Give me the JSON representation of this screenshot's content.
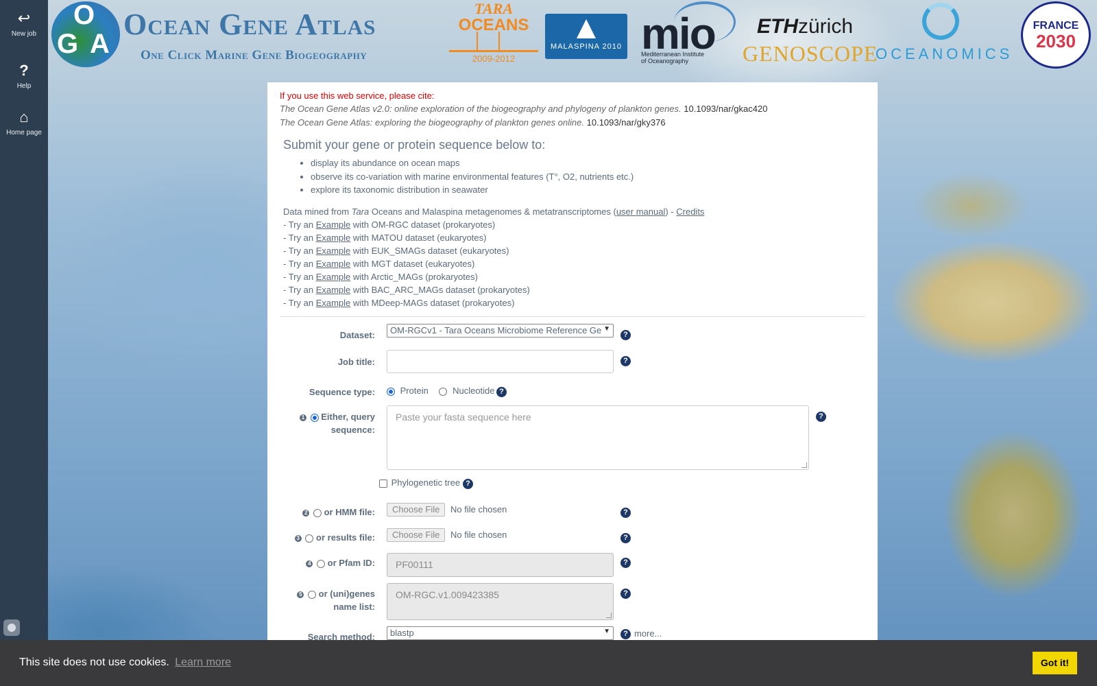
{
  "sidebar": {
    "items": [
      {
        "label": "New job",
        "icon": "undo-arrow-icon"
      },
      {
        "label": "Help",
        "icon": "question-icon"
      },
      {
        "label": "Home page",
        "icon": "home-icon"
      }
    ]
  },
  "header": {
    "logo_letters": [
      "O",
      "G",
      "A"
    ],
    "title": "Ocean Gene Atlas",
    "subtitle": "One Click Marine Gene Biogeography",
    "partner_logos": {
      "tara": {
        "line1": "TARA",
        "line2": "OCEANS",
        "years": "2009-2012"
      },
      "malaspina": {
        "text": "MALASPINA 2010"
      },
      "mio": {
        "big": "mio",
        "small1": "Mediterranean Institute",
        "small2": "of Oceanography"
      },
      "eth": {
        "bold": "ETH",
        "rest": "zürich"
      },
      "genoscope": {
        "text": "GENOSCOPE"
      },
      "oceanomics": {
        "text": "OCEANOMICS"
      },
      "france": {
        "line1": "FRANCE",
        "line2": "2030"
      }
    }
  },
  "citation": {
    "heading": "If you use this web service, please cite:",
    "refs": [
      {
        "title": "The Ocean Gene Atlas v2.0: online exploration of the biogeography and phylogeny of plankton genes.",
        "doi": "10.1093/nar/gkac420"
      },
      {
        "title": "The Ocean Gene Atlas: exploring the biogeography of plankton genes online.",
        "doi": "10.1093/nar/gky376"
      }
    ]
  },
  "intro": {
    "heading": "Submit your gene or protein sequence below to:",
    "bullets": [
      "display its abundance on ocean maps",
      "observe its co-variation with marine environmental features (T°, O2, nutrients etc.)",
      "explore its taxonomic distribution in seawater"
    ],
    "data_mined": {
      "prefix": "Data mined from ",
      "tara": "Tara",
      "middle": " Oceans and Malaspina metagenomes & metatranscriptomes (",
      "manual_link": "user manual",
      "sep": ") - ",
      "credits_link": "Credits"
    },
    "examples": [
      {
        "prefix": "- Try an ",
        "link": "Example",
        "suffix": " with OM-RGC dataset (prokaryotes)"
      },
      {
        "prefix": "- Try an ",
        "link": "Example",
        "suffix": " with MATOU dataset (eukaryotes)"
      },
      {
        "prefix": "- Try an ",
        "link": "Example",
        "suffix": " with EUK_SMAGs dataset (eukaryotes)"
      },
      {
        "prefix": "- Try an ",
        "link": "Example",
        "suffix": " with MGT dataset (eukaryotes)"
      },
      {
        "prefix": "- Try an ",
        "link": "Example",
        "suffix": " with Arctic_MAGs (prokaryotes)"
      },
      {
        "prefix": "- Try an ",
        "link": "Example",
        "suffix": " with BAC_ARC_MAGs dataset (prokaryotes)"
      },
      {
        "prefix": "- Try an ",
        "link": "Example",
        "suffix": " with MDeep-MAGs dataset (prokaryotes)"
      }
    ]
  },
  "form": {
    "dataset_label": "Dataset:",
    "dataset_value": "OM-RGCv1 - Tara Oceans Microbiome Reference Ge",
    "job_title_label": "Job title:",
    "sequence_type_label": "Sequence type:",
    "seq_protein": "Protein",
    "seq_nucleotide": "Nucleotide",
    "query_label_1": "Either, query",
    "query_label_2": "sequence:",
    "query_placeholder": "Paste your fasta sequence here",
    "phylo_label": "Phylogenetic tree",
    "hmm_label": "or HMM file:",
    "results_label": "or results file:",
    "choose_file": "Choose File",
    "no_file": "No file chosen",
    "pfam_label": "or Pfam ID:",
    "pfam_placeholder": "PF00111",
    "genes_label_1": "or (uni)genes",
    "genes_label_2": "name list:",
    "genes_placeholder": "OM-RGC.v1.009423385",
    "search_label": "Search method:",
    "search_value": "blastp",
    "more": "more...",
    "help_glyph": "?",
    "step_numbers": [
      "1",
      "2",
      "3",
      "4",
      "5"
    ]
  },
  "cookie": {
    "message": "This site does not use cookies.",
    "learn_more": "Learn more",
    "button": "Got it!"
  },
  "colors": {
    "sidebar": "#2d3e50",
    "title": "#3e76a8",
    "cite_heading": "#e00000",
    "help_icon": "#1d3766",
    "cookie_button": "#f1d600"
  }
}
